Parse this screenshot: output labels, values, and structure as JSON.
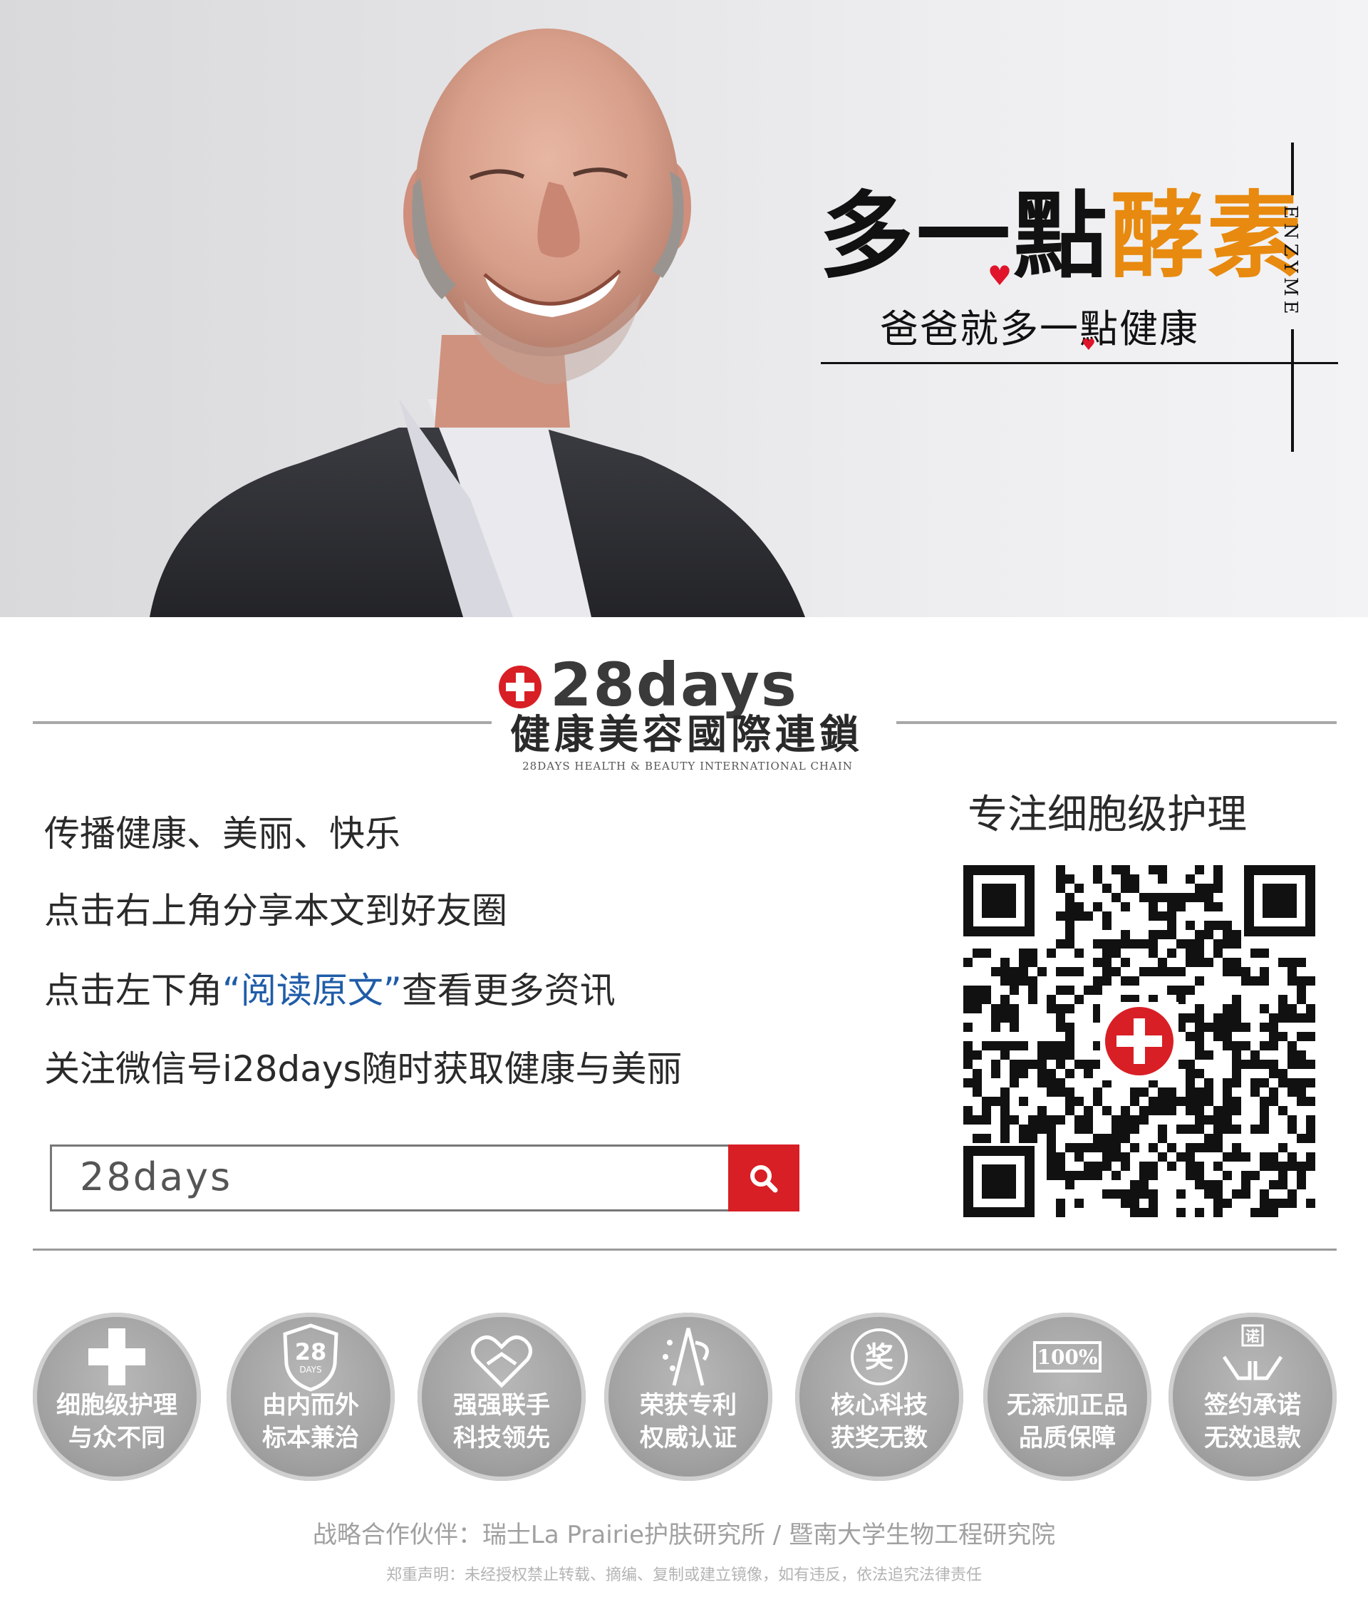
{
  "hero": {
    "headline_black": "多一點",
    "headline_orange": "酵素",
    "subline": "爸爸就多一點健康",
    "vertical_word": "ENZYME"
  },
  "brand": {
    "logo_word": "28days",
    "name_cn": "健康美容國際連鎖",
    "name_en": "28DAYS HEALTH & BEAUTY INTERNATIONAL CHAIN"
  },
  "info": {
    "line1": "传播健康、美丽、快乐",
    "line2": "点击右上角分享本文到好友圈",
    "line3_a": "点击左下角",
    "line3_link": "“阅读原文”",
    "line3_b": "查看更多资讯",
    "line4": "关注微信号i28days随时获取健康与美丽"
  },
  "qr": {
    "title": "专注细胞级护理"
  },
  "search": {
    "value": "28days",
    "icon": "search-icon"
  },
  "badges": [
    {
      "icon": "cross-icon",
      "top": "细胞级护理",
      "bottom": "与众不同"
    },
    {
      "icon": "shield-28-icon",
      "icon_text": "28",
      "icon_sub": "DAYS",
      "top": "由内而外",
      "bottom": "标本兼治"
    },
    {
      "icon": "handshake-icon",
      "top": "强强联手",
      "bottom": "科技领先"
    },
    {
      "icon": "patent-icon",
      "top": "荣获专利",
      "bottom": "权威认证"
    },
    {
      "icon": "award-icon",
      "icon_text": "奖",
      "top": "核心科技",
      "bottom": "获奖无数"
    },
    {
      "icon": "hundred-percent-icon",
      "icon_text": "100%",
      "top": "无添加正品",
      "bottom": "品质保障"
    },
    {
      "icon": "promise-hands-icon",
      "icon_text": "诺",
      "top": "签约承诺",
      "bottom": "无效退款"
    }
  ],
  "footer": {
    "partners": "战略合作伙伴：瑞士La Prairie护肤研究所 / 暨南大学生物工程研究院",
    "disclaimer": "郑重声明：未经授权禁止转载、摘编、复制或建立镜像，如有违反，依法追究法律责任"
  },
  "colors": {
    "accent_orange": "#e78a0f",
    "heart_red": "#e0142a",
    "brand_red": "#d81f25",
    "link_blue": "#1f5ca8"
  }
}
